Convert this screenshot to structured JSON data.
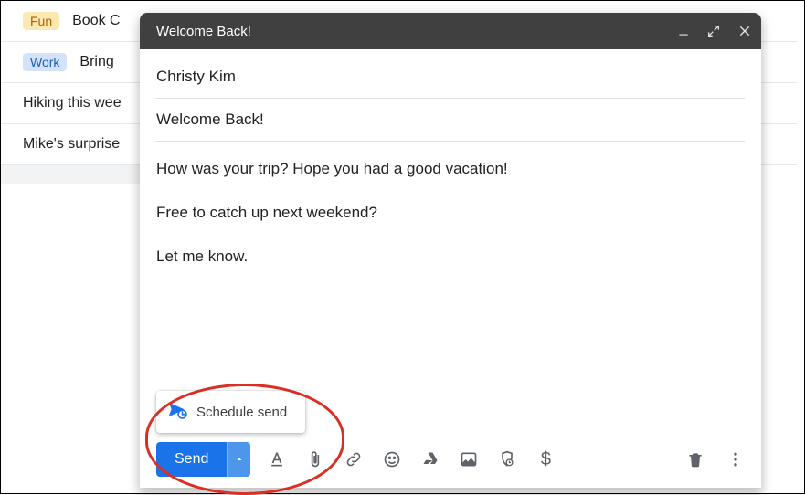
{
  "inbox": {
    "rows": [
      {
        "label": "Fun",
        "label_class": "label-fun",
        "subject": "Book C"
      },
      {
        "label": "Work",
        "label_class": "label-work",
        "subject": "Bring"
      },
      {
        "label": null,
        "subject": "Hiking this wee"
      },
      {
        "label": null,
        "subject": "Mike's surprise"
      }
    ]
  },
  "compose": {
    "header_title": "Welcome Back!",
    "to": "Christy Kim",
    "subject": "Welcome Back!",
    "body_lines": [
      "How was your trip? Hope you had a good vacation!",
      "Free to catch up next weekend?",
      "Let me know."
    ],
    "send_label": "Send",
    "schedule_label": "Schedule send"
  },
  "colors": {
    "accent": "#1a73e8",
    "callout": "#d93025"
  }
}
